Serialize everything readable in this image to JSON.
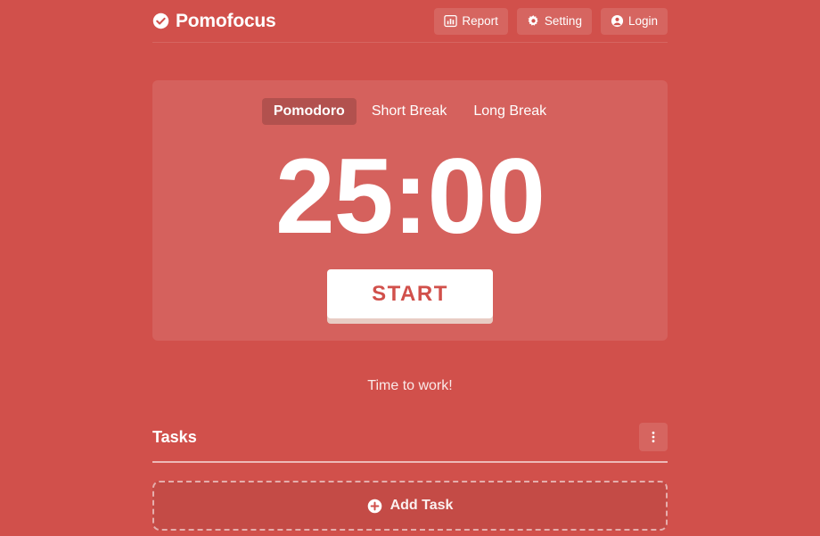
{
  "app": {
    "brand_name": "Pomofocus",
    "brand_icon": "check-circle-icon",
    "background_color": "#d1504b",
    "accent_color": "#ffffff"
  },
  "header": {
    "buttons": [
      {
        "label": "Report",
        "icon": "chart-bar-icon"
      },
      {
        "label": "Setting",
        "icon": "gear-icon"
      },
      {
        "label": "Login",
        "icon": "user-circle-icon"
      }
    ]
  },
  "timer": {
    "modes": [
      {
        "label": "Pomodoro",
        "active": true
      },
      {
        "label": "Short Break",
        "active": false
      },
      {
        "label": "Long Break",
        "active": false
      }
    ],
    "display": "25:00",
    "minutes": "25",
    "seconds": "00",
    "start_label": "START"
  },
  "status": {
    "message": "Time to work!"
  },
  "tasks": {
    "title": "Tasks",
    "menu_icon": "ellipsis-vertical-icon",
    "add_task_label": "Add Task",
    "add_task_icon": "plus-circle-icon",
    "items": []
  }
}
